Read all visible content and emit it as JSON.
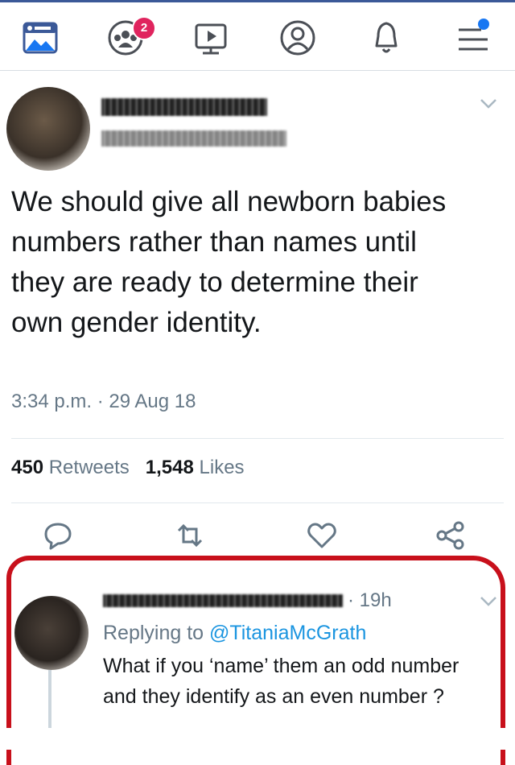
{
  "nav": {
    "items": [
      {
        "icon": "news-feed-icon",
        "active": true
      },
      {
        "icon": "groups-icon",
        "badge": "2"
      },
      {
        "icon": "watch-video-icon"
      },
      {
        "icon": "profile-icon"
      },
      {
        "icon": "notifications-bell-icon"
      },
      {
        "icon": "menu-icon",
        "dot": true
      }
    ],
    "badge_count": "2",
    "accent_color": "#3b5998",
    "badge_color": "#e0245e"
  },
  "tweet": {
    "text": "We should give all newborn babies numbers rather than names until they are ready to determine their own gender identity.",
    "time": "3:34 p.m. · 29 Aug 18",
    "retweets_count": "450",
    "retweets_label": "Retweets",
    "likes_count": "1,548",
    "likes_label": "Likes"
  },
  "reply": {
    "time": "· 19h",
    "replying_prefix": "Replying to",
    "replying_handle": "@TitaniaMcGrath",
    "text": "What if you ‘name’ them an odd number and they identify as an even number ?",
    "link_color": "#1b95e0",
    "highlight_color": "#c8101b"
  }
}
